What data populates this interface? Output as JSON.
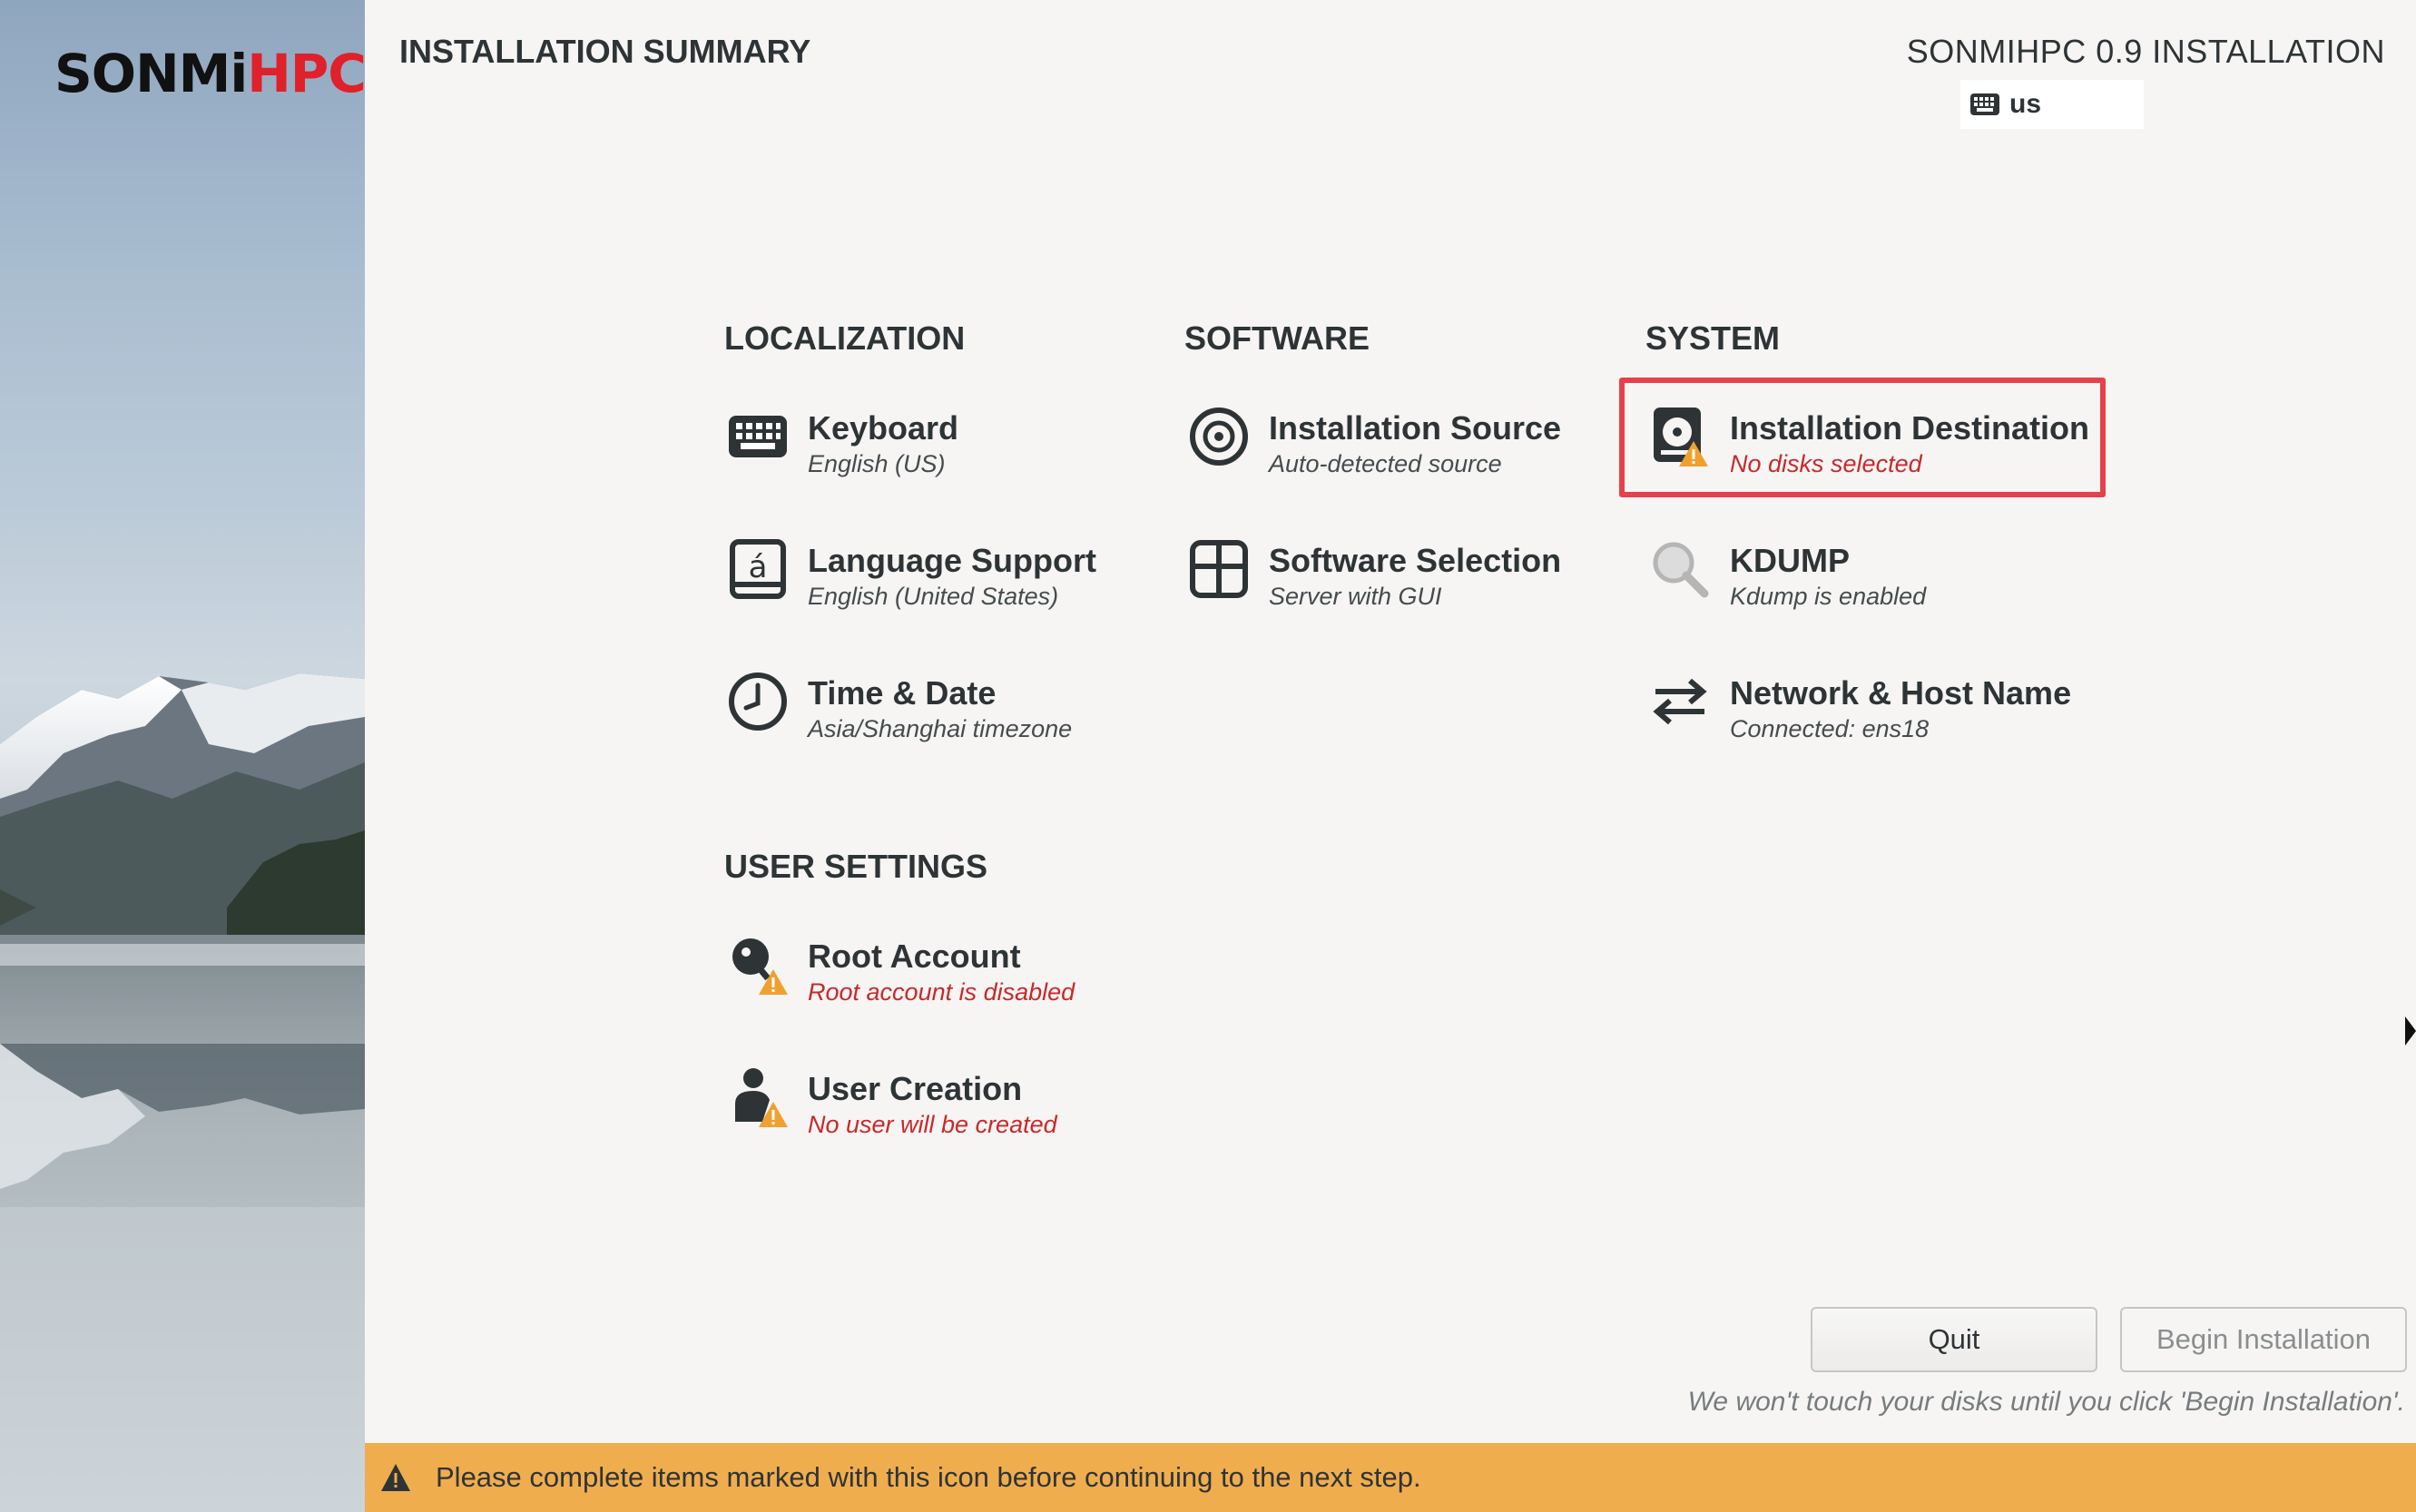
{
  "brand": {
    "logo_part1": "SONMi",
    "logo_part2": "HPC"
  },
  "header": {
    "title": "INSTALLATION SUMMARY",
    "product": "SONMIHPC 0.9 INSTALLATION",
    "keyboard_layout": "us"
  },
  "sections": {
    "localization": {
      "title": "LOCALIZATION",
      "items": [
        {
          "name": "Keyboard",
          "status": "English (US)"
        },
        {
          "name": "Language Support",
          "status": "English (United States)"
        },
        {
          "name": "Time & Date",
          "status": "Asia/Shanghai timezone"
        }
      ]
    },
    "software": {
      "title": "SOFTWARE",
      "items": [
        {
          "name": "Installation Source",
          "status": "Auto-detected source"
        },
        {
          "name": "Software Selection",
          "status": "Server with GUI"
        }
      ]
    },
    "system": {
      "title": "SYSTEM",
      "items": [
        {
          "name": "Installation Destination",
          "status": "No disks selected",
          "warning": true
        },
        {
          "name": "KDUMP",
          "status": "Kdump is enabled"
        },
        {
          "name": "Network & Host Name",
          "status": "Connected: ens18"
        }
      ]
    },
    "user_settings": {
      "title": "USER SETTINGS",
      "items": [
        {
          "name": "Root Account",
          "status": "Root account is disabled",
          "warning": true
        },
        {
          "name": "User Creation",
          "status": "No user will be created",
          "warning": true
        }
      ]
    }
  },
  "buttons": {
    "quit": "Quit",
    "begin": "Begin Installation"
  },
  "hint": "We won't touch your disks until you click 'Begin Installation'.",
  "warning_bar": {
    "text": "Please complete items marked with this icon before continuing to the next step."
  },
  "colors": {
    "warning_bar": "#f0ad4e",
    "warning_text": "#c8292a",
    "focus_border": "#e8404a",
    "warning_icon": "#f0a030"
  }
}
